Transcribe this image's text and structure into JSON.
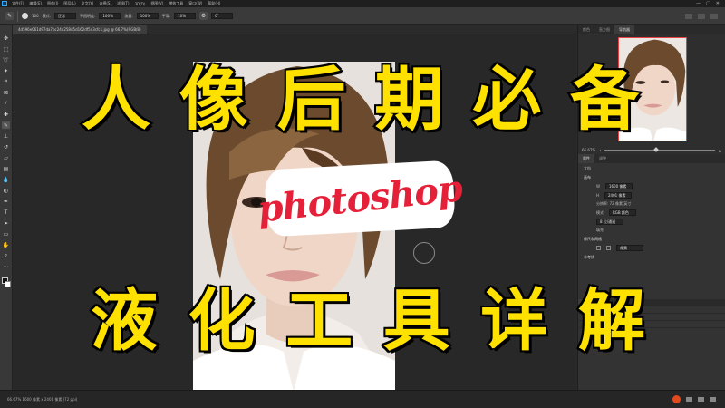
{
  "menubar": {
    "items": [
      "文件(F)",
      "编辑(E)",
      "图像(I)",
      "图层(L)",
      "文字(Y)",
      "选择(S)",
      "滤镜(T)",
      "3D(D)",
      "视图(V)",
      "增效工具",
      "窗口(W)",
      "帮助(H)"
    ],
    "window_buttons": [
      "—",
      "▢",
      "✕"
    ]
  },
  "options": {
    "size_value": "100",
    "mode_label": "模式:",
    "mode_value": "正常",
    "opacity_label": "不透明度:",
    "opacity_value": "100%",
    "flow_label": "流量:",
    "flow_value": "100%",
    "smooth_label": "平滑:",
    "smooth_value": "10%",
    "angle_value": "0°"
  },
  "document": {
    "tab_label": "4d596e061d97da7bc24d258d5d162df5d3cfc1.jpg @ 66.7%(RGB/8)"
  },
  "overlay": {
    "title_top": [
      "人",
      "像",
      "后",
      "期",
      "必",
      "备"
    ],
    "title_bottom": [
      "液",
      "化",
      "工",
      "具",
      "详",
      "解"
    ],
    "badge": "photoshop"
  },
  "rightpanel": {
    "tabs": [
      "颜色",
      "直方图",
      "导航器"
    ],
    "zoom_value": "66.67%",
    "props_tabs": [
      "属性",
      "调整"
    ],
    "doc_label": "文档",
    "canvas_header": "画布",
    "width_value": "1600 像素",
    "height_value": "2401 像素",
    "resolution_text": "分辨率: 72 像素/英寸",
    "mode_label": "模式",
    "mode_value": "RGB 颜色",
    "bits_value": "8 位/通道",
    "fill_label": "填充",
    "guides_header": "标尺和网格",
    "unit_value": "像素",
    "quick_header": "参考线",
    "layers_tabs": [
      "图层",
      "通道",
      "路径"
    ]
  },
  "statusbar": {
    "info": "66.67%   1600 像素 x 2401 像素 (72 ppi)"
  }
}
